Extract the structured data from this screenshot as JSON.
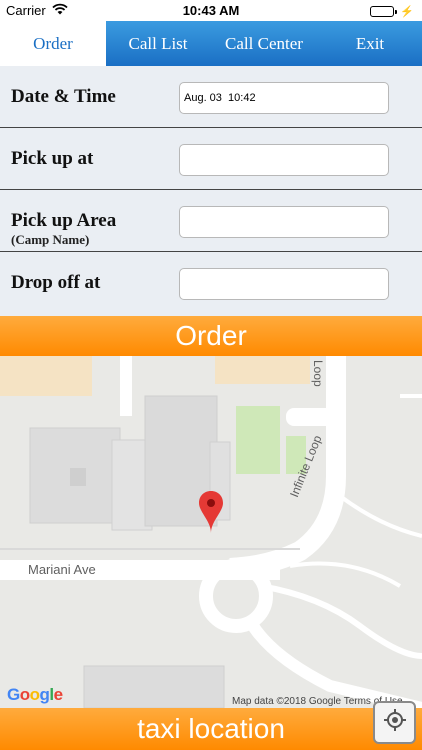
{
  "status_bar": {
    "carrier": "Carrier",
    "time": "10:43 AM"
  },
  "tabs": [
    {
      "label": "Order",
      "active": true
    },
    {
      "label": "Call List",
      "active": false
    },
    {
      "label": "Call Center",
      "active": false
    },
    {
      "label": "Exit",
      "active": false
    }
  ],
  "form": {
    "date_time": {
      "label": "Date & Time",
      "value": "Aug. 03  10:42"
    },
    "pick_up_at": {
      "label": "Pick up at",
      "value": ""
    },
    "pick_up_area": {
      "label": "Pick up Area",
      "sublabel": "(Camp Name)",
      "value": ""
    },
    "drop_off_at": {
      "label": "Drop off at",
      "value": ""
    }
  },
  "order_button": {
    "label": "Order"
  },
  "map": {
    "street_labels": {
      "mariani": "Mariani Ave",
      "infinite": "Infinite Loop",
      "loop": "Loop"
    },
    "logo": {
      "g1": "G",
      "o1": "o",
      "o2": "o",
      "g2": "g",
      "l": "l",
      "e": "e"
    },
    "attribution": "Map data ©2018 Google    Terms of Use",
    "pin_icon": "map-pin-icon"
  },
  "taxi_location_button": {
    "label": "taxi location"
  },
  "location_button": {
    "icon": "crosshair-icon"
  },
  "colors": {
    "tab_bar": "#1a6fc4",
    "accent_orange": "#ff8a00",
    "form_background": "#eaeef3",
    "pin_red": "#e53935"
  }
}
